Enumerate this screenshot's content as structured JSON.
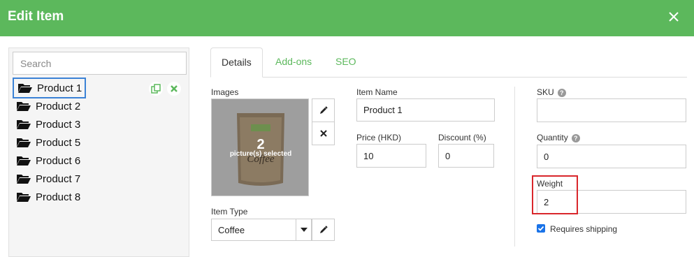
{
  "header": {
    "title": "Edit Item"
  },
  "sidebar": {
    "search_placeholder": "Search",
    "items": [
      {
        "label": "Product 1"
      },
      {
        "label": "Product 2"
      },
      {
        "label": "Product 3"
      },
      {
        "label": "Product 5"
      },
      {
        "label": "Product 6"
      },
      {
        "label": "Product 7"
      },
      {
        "label": "Product 8"
      }
    ]
  },
  "tabs": [
    {
      "label": "Details"
    },
    {
      "label": "Add-ons"
    },
    {
      "label": "SEO"
    }
  ],
  "form": {
    "images_label": "Images",
    "picture_count": "2",
    "picture_text": "picture(s) selected",
    "item_name_label": "Item Name",
    "item_name_value": "Product 1",
    "price_label": "Price (HKD)",
    "price_value": "10",
    "discount_label": "Discount (%)",
    "discount_value": "0",
    "item_type_label": "Item Type",
    "item_type_value": "Coffee",
    "sku_label": "SKU",
    "sku_value": "",
    "quantity_label": "Quantity",
    "quantity_value": "0",
    "weight_label": "Weight",
    "weight_value": "2",
    "requires_shipping_label": "Requires shipping",
    "requires_shipping_checked": true,
    "image_product_text": "Coffee"
  },
  "colors": {
    "header": "#5cb85c",
    "tab_accent": "#5cb85c",
    "highlight": "#d9262b",
    "selection": "#3b82d6"
  }
}
